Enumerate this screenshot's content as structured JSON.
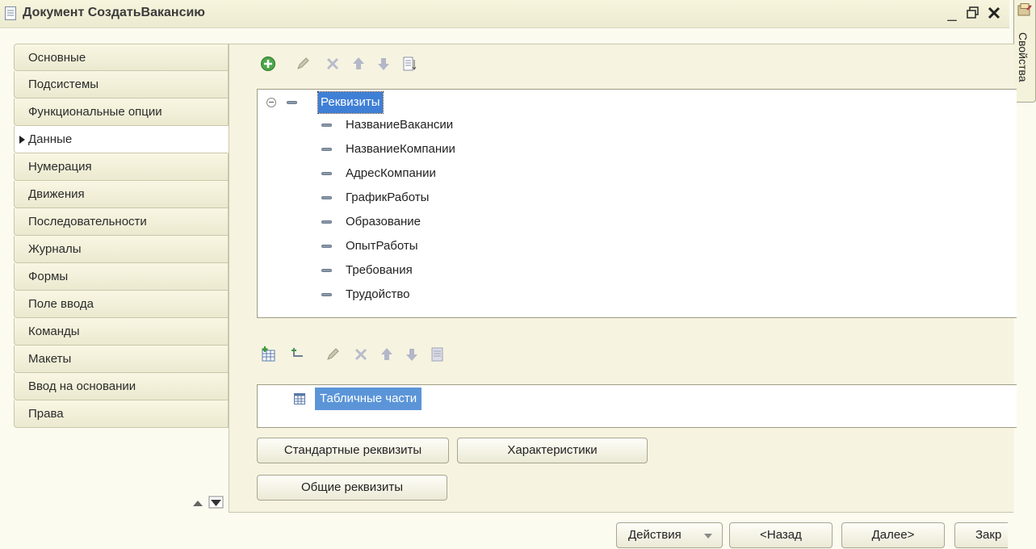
{
  "window": {
    "title": "Документ СоздатьВакансию",
    "minimize": "_",
    "restore": "🗗",
    "close": "✕"
  },
  "properties_panel": {
    "label": "Свойства"
  },
  "tabs": [
    {
      "label": "Основные"
    },
    {
      "label": "Подсистемы"
    },
    {
      "label": "Функциональные опции"
    },
    {
      "label": "Данные",
      "active": true
    },
    {
      "label": "Нумерация"
    },
    {
      "label": "Движения"
    },
    {
      "label": "Последовательности"
    },
    {
      "label": "Журналы"
    },
    {
      "label": "Формы"
    },
    {
      "label": "Поле ввода"
    },
    {
      "label": "Команды"
    },
    {
      "label": "Макеты"
    },
    {
      "label": "Ввод на основании"
    },
    {
      "label": "Права"
    }
  ],
  "attributes_toolbar": [
    "add-icon",
    "edit-icon",
    "delete-icon",
    "move-up-icon",
    "move-down-icon",
    "sort-icon"
  ],
  "attributes_tree": {
    "root": "Реквизиты",
    "items": [
      "НазваниеВакансии",
      "НазваниеКомпании",
      "АдресКомпании",
      "ГрафикРаботы",
      "Образование",
      "ОпытРаботы",
      "Требования",
      "Трудойство"
    ]
  },
  "tabular_toolbar": [
    "add-table-icon",
    "add-column-icon",
    "edit-icon",
    "delete-icon",
    "move-up-icon",
    "move-down-icon",
    "sort-icon"
  ],
  "tabular_parts": {
    "label": "Табличные части"
  },
  "buttons": {
    "standard_attributes": "Стандартные реквизиты",
    "characteristics": "Характеристики",
    "common_attributes": "Общие реквизиты"
  },
  "footer": {
    "actions": "Действия",
    "back": "<Назад",
    "next": "Далее>",
    "close": "Закр"
  },
  "colors": {
    "selection": "#3f7fd6",
    "background": "#fbfbf0",
    "tab_bg": "#ebe9cf"
  }
}
